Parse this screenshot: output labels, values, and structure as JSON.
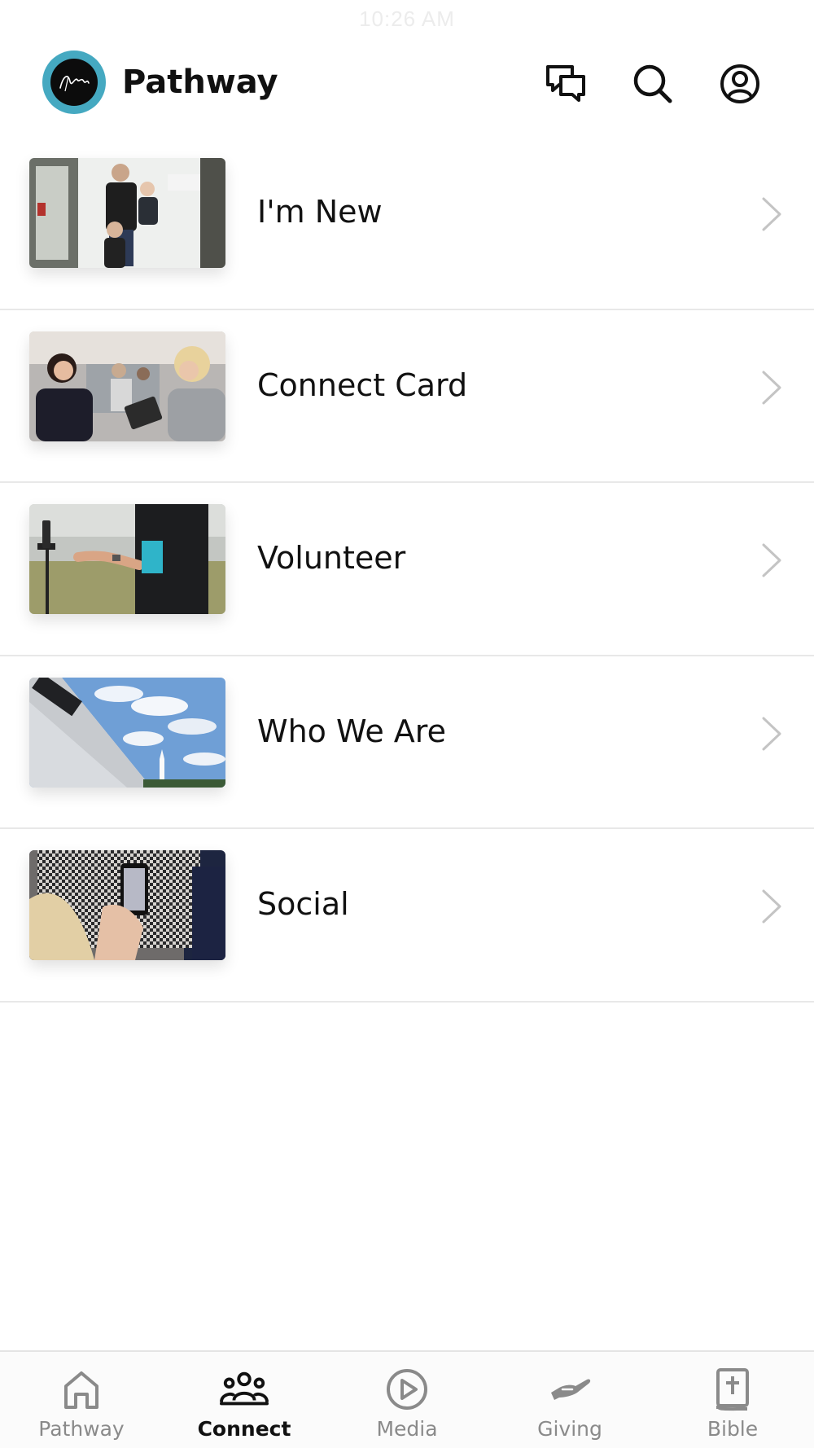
{
  "status_bar": {
    "time": "10:26 AM"
  },
  "header": {
    "title": "Pathway",
    "logo_text": "pathway",
    "icons": [
      "chat-icon",
      "search-icon",
      "profile-icon"
    ]
  },
  "menu": [
    {
      "label": "I'm New",
      "image": "family-at-door-photo"
    },
    {
      "label": "Connect Card",
      "image": "women-talking-photo"
    },
    {
      "label": "Volunteer",
      "image": "volunteer-photo"
    },
    {
      "label": "Who We Are",
      "image": "church-building-photo"
    },
    {
      "label": "Social",
      "image": "phone-photo"
    }
  ],
  "tabs": [
    {
      "label": "Pathway",
      "icon": "home-icon",
      "active": false
    },
    {
      "label": "Connect",
      "icon": "people-icon",
      "active": true
    },
    {
      "label": "Media",
      "icon": "play-icon",
      "active": false
    },
    {
      "label": "Giving",
      "icon": "giving-hand-icon",
      "active": false
    },
    {
      "label": "Bible",
      "icon": "bible-icon",
      "active": false
    }
  ],
  "colors": {
    "logo_ring": "#45a9c1",
    "divider": "#e8e8e8",
    "inactive_tab": "#8a8a8a",
    "active_tab": "#111111"
  }
}
